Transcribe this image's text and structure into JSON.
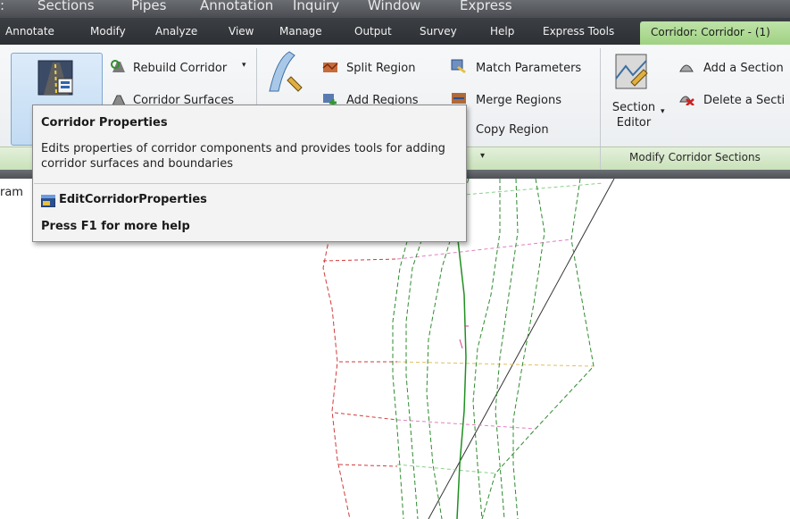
{
  "menubar": {
    "items": [
      "Sections",
      "Pipes",
      "Annotation",
      "Inquiry",
      "Window",
      "Express"
    ]
  },
  "tabs": {
    "items": [
      "Annotate",
      "Modify",
      "Analyze",
      "View",
      "Manage",
      "Output",
      "Survey",
      "Help",
      "Express Tools"
    ],
    "active": "Corridor: Corridor - (1)"
  },
  "ribbon": {
    "rebuild_corridor": "Rebuild Corridor",
    "corridor_surfaces": "Corridor Surfaces",
    "split_region": "Split Region",
    "add_regions": "Add Regions",
    "match_parameters": "Match Parameters",
    "merge_regions": "Merge Regions",
    "copy_region": "Copy Region",
    "section_editor": "Section Editor",
    "add_section": "Add a Section",
    "delete_section": "Delete a Secti",
    "group_modify_corridor_sections": "Modify Corridor Sections"
  },
  "canvas": {
    "frame_label": "ram"
  },
  "tooltip": {
    "title": "Corridor Properties",
    "description": "Edits properties of corridor components and provides tools for adding corridor surfaces and boundaries",
    "command": "EditCorridorProperties",
    "help": "Press F1 for more help"
  },
  "colors": {
    "active_tab": "#a9d78d",
    "ribbon_group_row": "#d3e8c4",
    "tooltip_bg": "#f3f3f3"
  }
}
